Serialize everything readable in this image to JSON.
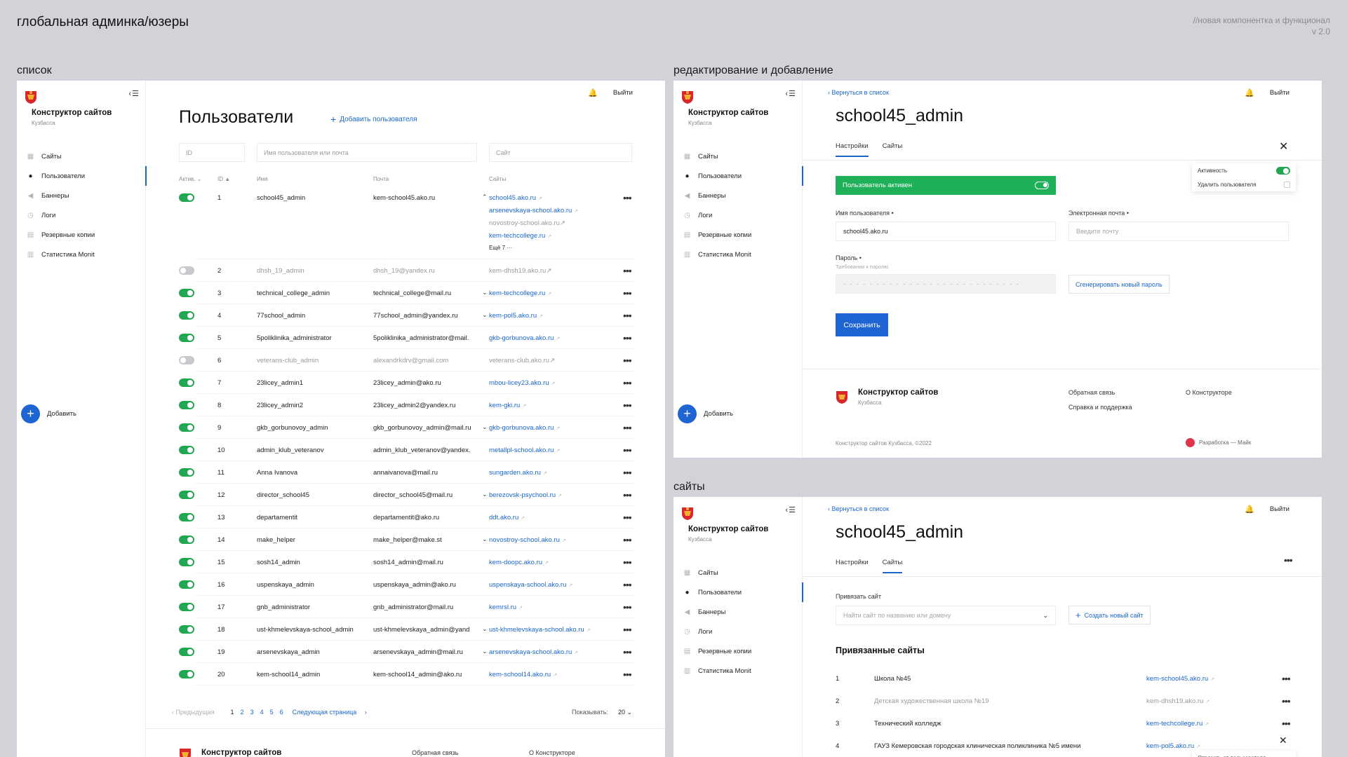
{
  "page": {
    "title": "глобальная админка/юзеры",
    "note_line1": "//новая компонентка и функционал",
    "note_line2": "v 2.0"
  },
  "sections": {
    "list": "список",
    "edit": "редактирование и добавление",
    "sites": "сайты"
  },
  "sidebar": {
    "brand": "Конструктор сайтов",
    "brand_sub": "Кузбасса",
    "items": [
      {
        "label": "Сайты",
        "icon": "grid-icon"
      },
      {
        "label": "Пользователи",
        "icon": "user-icon"
      },
      {
        "label": "Баннеры",
        "icon": "megaphone-icon"
      },
      {
        "label": "Логи",
        "icon": "clock-icon"
      },
      {
        "label": "Резервные копии",
        "icon": "document-icon"
      },
      {
        "label": "Статистика Monit",
        "icon": "chart-icon"
      }
    ],
    "add": "Добавить"
  },
  "topbar": {
    "logout": "Выйти"
  },
  "users_page": {
    "title": "Пользователи",
    "add_user": "Добавить пользователя",
    "filters": {
      "id": "ID",
      "name": "Имя пользователя или почта",
      "site": "Сайт"
    },
    "columns": {
      "active": "Актив.",
      "id": "ID",
      "name": "Имя",
      "email": "Почта",
      "sites": "Сайты"
    },
    "first_row_extra_sites": [
      "arsenevskaya-school.ako.ru",
      "novostroy-school.ako.ru",
      "kem-techcollege.ru"
    ],
    "first_row_more": "Ещё 7",
    "rows": [
      {
        "id": "1",
        "name": "school45_admin",
        "email": "kem-school45.ako.ru",
        "site": "school45.ako.ru",
        "active": true,
        "expanded": true
      },
      {
        "id": "2",
        "name": "dhsh_19_admin",
        "email": "dhsh_19@yandex.ru",
        "site": "kem-dhsh19.ako.ru",
        "active": false
      },
      {
        "id": "3",
        "name": "technical_college_admin",
        "email": "technical_college@mail.ru",
        "site": "kem-techcollege.ru",
        "active": true,
        "chevron": true
      },
      {
        "id": "4",
        "name": "77school_admin",
        "email": "77school_admin@yandex.ru",
        "site": "kem-pol5.ako.ru",
        "active": true,
        "chevron": true
      },
      {
        "id": "5",
        "name": "5poliklinika_administrator",
        "email": "5poliklinika_administrator@mail.",
        "site": "gkb-gorbunova.ako.ru",
        "active": true
      },
      {
        "id": "6",
        "name": "veterans-club_admin",
        "email": "alexandrkdrv@gmail.com",
        "site": "veterans-club.ako.ru",
        "active": false
      },
      {
        "id": "7",
        "name": "23licey_admin1",
        "email": "23licey_admin@ako.ru",
        "site": "mbou-licey23.ako.ru",
        "active": true
      },
      {
        "id": "8",
        "name": "23licey_admin2",
        "email": "23licey_admin2@yandex.ru",
        "site": "kem-gki.ru",
        "active": true
      },
      {
        "id": "9",
        "name": "gkb_gorbunovoy_admin",
        "email": "gkb_gorbunovoy_admin@mail.ru",
        "site": "gkb-gorbunova.ako.ru",
        "active": true,
        "chevron": true
      },
      {
        "id": "10",
        "name": "admin_klub_veteranov",
        "email": "admin_klub_veteranov@yandex.",
        "site": "metallpl-school.ako.ru",
        "active": true
      },
      {
        "id": "11",
        "name": "Anna Ivanova",
        "email": "annaivanova@mail.ru",
        "site": "sungarden.ako.ru",
        "active": true
      },
      {
        "id": "12",
        "name": "director_school45",
        "email": "director_school45@mail.ru",
        "site": "berezovsk-psychool.ru",
        "active": true,
        "chevron": true
      },
      {
        "id": "13",
        "name": "departamentit",
        "email": "departamentit@ako.ru",
        "site": "ddt.ako.ru",
        "active": true
      },
      {
        "id": "14",
        "name": "make_helper",
        "email": "make_helper@make.st",
        "site": "novostroy-school.ako.ru",
        "active": true,
        "chevron": true
      },
      {
        "id": "15",
        "name": "sosh14_admin",
        "email": "sosh14_admin@mail.ru",
        "site": "kem-doopc.ako.ru",
        "active": true
      },
      {
        "id": "16",
        "name": "uspenskaya_admin",
        "email": "uspenskaya_admin@ako.ru",
        "site": "uspenskaya-school.ako.ru",
        "active": true
      },
      {
        "id": "17",
        "name": "gnb_administrator",
        "email": "gnb_administrator@mail.ru",
        "site": "kemrsl.ru",
        "active": true
      },
      {
        "id": "18",
        "name": "ust-khmelevskaya-school_admin",
        "email": "ust-khmelevskaya_admin@yand",
        "site": "ust-khmelevskaya-school.ako.ru",
        "active": true,
        "chevron": true
      },
      {
        "id": "19",
        "name": "arsenevskaya_admin",
        "email": "arsenevskaya_admin@mail.ru",
        "site": "arsenevskaya-school.ako.ru",
        "active": true,
        "chevron": true
      },
      {
        "id": "20",
        "name": "kem-school14_admin",
        "email": "kem-school14_admin@ako.ru",
        "site": "kem-school14.ako.ru",
        "active": true
      }
    ],
    "pager": {
      "prev": "Предыдущая",
      "pages": [
        "1",
        "2",
        "3",
        "4",
        "5",
        "6"
      ],
      "next": "Следующая страница",
      "show_label": "Показывать:",
      "show_value": "20"
    }
  },
  "footer": {
    "brand": "Конструктор сайтов",
    "brand_sub": "Кузбасса",
    "feedback": "Обратная связь",
    "about": "О Конструкторе",
    "help": "Справка и поддержка",
    "copyright": "Конструктор сайтов Кузбасса, ©2022",
    "dev": "Разработка — Майк"
  },
  "edit_page": {
    "back": "Вернуться в список",
    "title": "school45_admin",
    "tabs": [
      "Настройки",
      "Сайты"
    ],
    "active_banner": "Пользователь активен",
    "popup": {
      "activity": "Активность",
      "delete": "Удалить пользователя"
    },
    "username_label": "Имя пользователя •",
    "username_value": "school45.ako.ru",
    "email_label": "Электронная почта •",
    "email_placeholder": "Введите почту",
    "password_label": "Пароль •",
    "password_hint": "Требования к паролю",
    "password_dots": "- - - - - - - - - - - - - - - - - - - - - - - - - - -",
    "generate": "Сгенерировать новый пароль",
    "save": "Сохранить"
  },
  "sites_page": {
    "back": "Вернуться в список",
    "title": "school45_admin",
    "tabs": [
      "Настройки",
      "Сайты"
    ],
    "bind_label": "Привязать сайт",
    "bind_placeholder": "Найти сайт по названию или домену",
    "create": "Создать новый сайт",
    "bound_title": "Привязанные сайты",
    "bound": [
      {
        "n": "1",
        "name": "Школа №45",
        "domain": "kem-school45.ako.ru",
        "muted": false
      },
      {
        "n": "2",
        "name": "Детская художественная школа №19",
        "domain": "kem-dhsh19.ako.ru",
        "muted": true
      },
      {
        "n": "3",
        "name": "Технический колледж",
        "domain": "kem-techcollege.ru",
        "muted": false
      },
      {
        "n": "4",
        "name": "ГАУЗ Кемеровская городская клиническая поликлиника №5 имени",
        "domain": "kem-pol5.ako.ru",
        "muted": false
      }
    ],
    "row_popup": "Отвязать от пользователя"
  }
}
